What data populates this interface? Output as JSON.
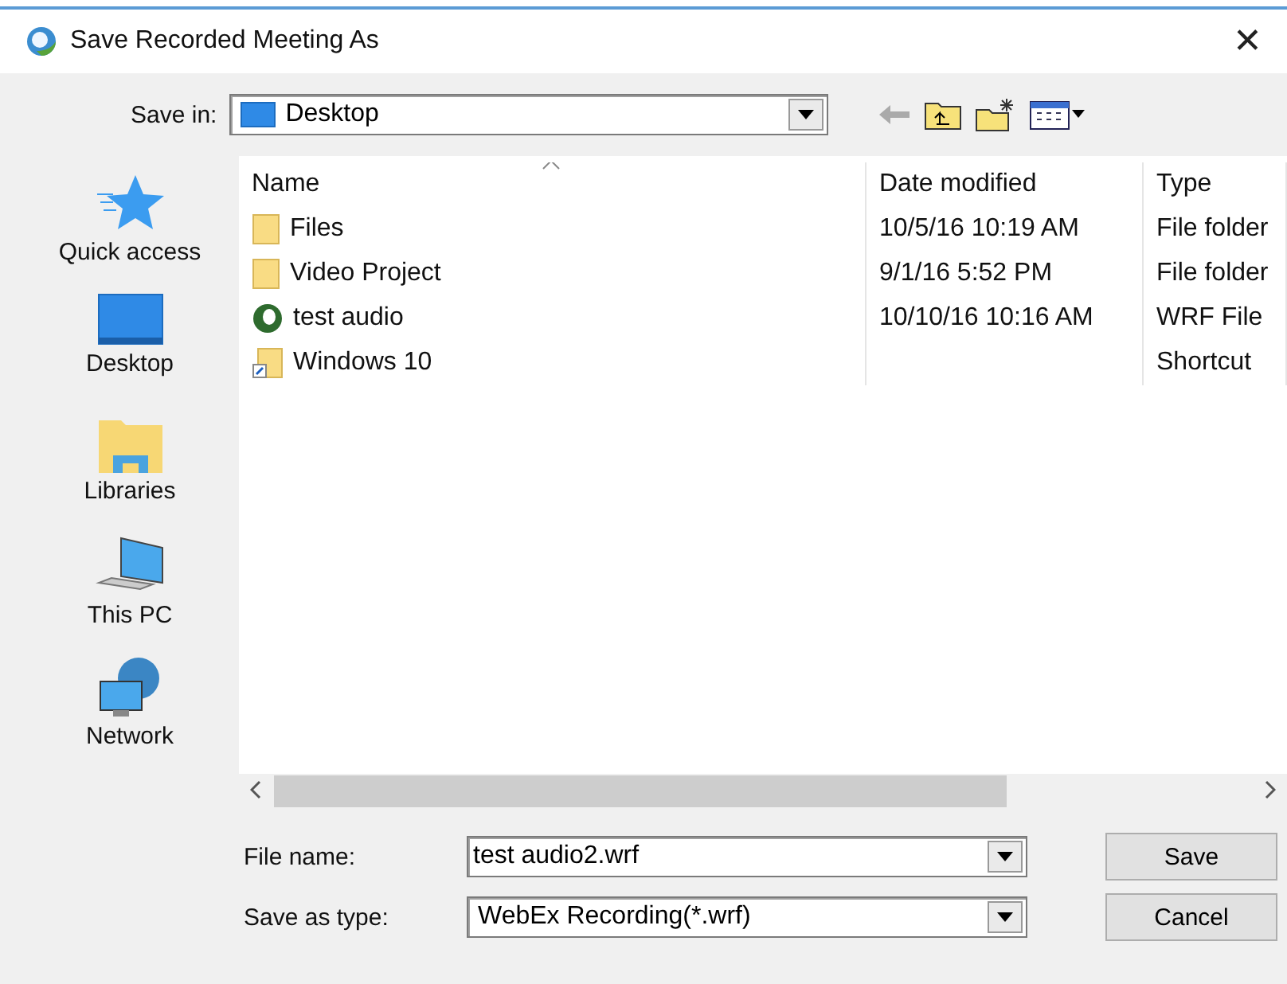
{
  "window": {
    "title": "Save Recorded Meeting As",
    "close": "✕"
  },
  "toolbar": {
    "save_in_label": "Save in:",
    "save_in_value": "Desktop"
  },
  "places": [
    {
      "label": "Quick access",
      "kind": "star"
    },
    {
      "label": "Desktop",
      "kind": "desktop"
    },
    {
      "label": "Libraries",
      "kind": "libraries"
    },
    {
      "label": "This PC",
      "kind": "pc"
    },
    {
      "label": "Network",
      "kind": "network"
    }
  ],
  "table": {
    "columns": [
      "Name",
      "Date modified",
      "Type"
    ],
    "rows": [
      {
        "name": "Files",
        "date": "10/5/16 10:19 AM",
        "type": "File folder",
        "kind": "folder"
      },
      {
        "name": "Video Project",
        "date": "9/1/16 5:52 PM",
        "type": "File folder",
        "kind": "folder"
      },
      {
        "name": "test audio",
        "date": "10/10/16 10:16 AM",
        "type": "WRF File",
        "kind": "wrf"
      },
      {
        "name": "Windows 10",
        "date": "",
        "type": "Shortcut",
        "kind": "shortcut"
      }
    ]
  },
  "file_name": {
    "label": "File name:",
    "value": "test audio2.wrf"
  },
  "save_as_type": {
    "label": "Save as type:",
    "value": "WebEx Recording(*.wrf)"
  },
  "buttons": [
    "Save",
    "Cancel"
  ]
}
